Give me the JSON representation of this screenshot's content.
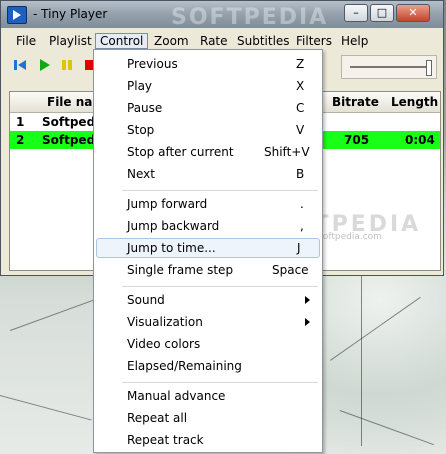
{
  "window": {
    "title": "- Tiny Player",
    "watermark": "SOFTPEDIA",
    "controls": {
      "minimize": "–",
      "maximize": "□",
      "close": "✕"
    }
  },
  "menubar": [
    "File",
    "Playlist",
    "Control",
    "Zoom",
    "Rate",
    "Subtitles",
    "Filters",
    "Help"
  ],
  "active_menu": "Control",
  "toolbar": {
    "icons": [
      "skip-back-icon",
      "play-icon",
      "pause-icon",
      "stop-icon"
    ],
    "colors": {
      "skip": "#1e73d6",
      "play": "#14a814",
      "pause": "#e0c400",
      "stop": "#e00000"
    }
  },
  "playlist": {
    "headers": {
      "num": "",
      "file": "File nar",
      "bitrate": "Bitrate",
      "length": "Length"
    },
    "rows": [
      {
        "num": "1",
        "file": "Softped",
        "bitrate": "",
        "length": ""
      },
      {
        "num": "2",
        "file": "Softped",
        "bitrate": "705",
        "length": "0:04"
      }
    ],
    "playing_color": "#18ff18"
  },
  "background_watermark": {
    "text": "SOFTPEDIA",
    "url": "www.softpedia.com"
  },
  "control_menu": {
    "items": [
      {
        "label": "Previous",
        "shortcut": "Z"
      },
      {
        "label": "Play",
        "shortcut": "X"
      },
      {
        "label": "Pause",
        "shortcut": "C"
      },
      {
        "label": "Stop",
        "shortcut": "V"
      },
      {
        "label": "Stop after current",
        "shortcut": "Shift+V"
      },
      {
        "label": "Next",
        "shortcut": "B"
      },
      {
        "label": "Jump forward",
        "shortcut": "."
      },
      {
        "label": "Jump backward",
        "shortcut": ","
      },
      {
        "label": "Jump to time...",
        "shortcut": "J"
      },
      {
        "label": "Single frame step",
        "shortcut": "Space"
      },
      {
        "label": "Sound",
        "shortcut": ""
      },
      {
        "label": "Visualization",
        "shortcut": ""
      },
      {
        "label": "Video colors",
        "shortcut": ""
      },
      {
        "label": "Elapsed/Remaining",
        "shortcut": ""
      },
      {
        "label": "Manual advance",
        "shortcut": ""
      },
      {
        "label": "Repeat all",
        "shortcut": ""
      },
      {
        "label": "Repeat track",
        "shortcut": ""
      }
    ],
    "highlighted": "Jump to time..."
  }
}
